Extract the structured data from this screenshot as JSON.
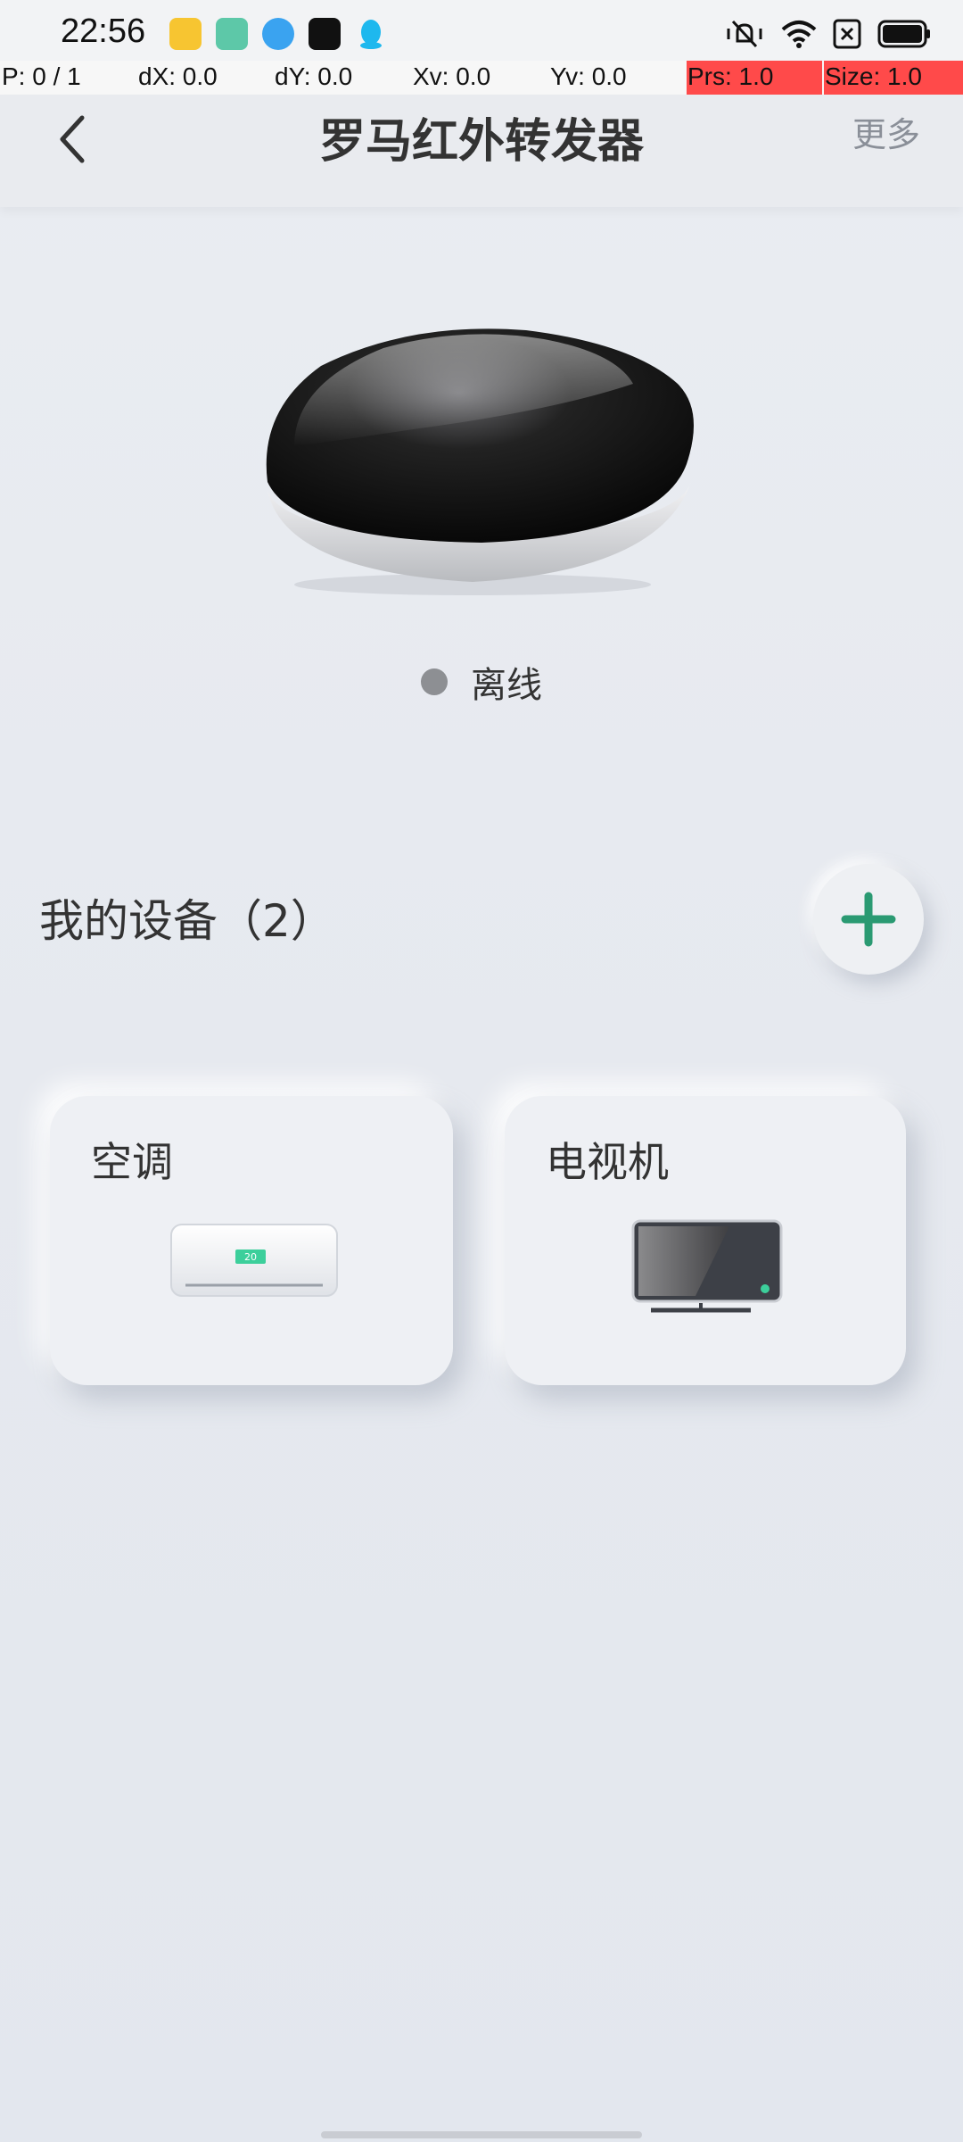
{
  "status_bar": {
    "time": "22:56"
  },
  "debug_bar": {
    "pointer": "P: 0 / 1",
    "dx": "dX: 0.0",
    "dy": "dY: 0.0",
    "xv": "Xv: 0.0",
    "yv": "Yv: 0.0",
    "prs": "Prs: 1.0",
    "size": "Size: 1.0"
  },
  "header": {
    "title": "罗马红外转发器",
    "more_label": "更多"
  },
  "device": {
    "status_text": "离线",
    "status_color": "#8d8f93"
  },
  "my_devices": {
    "title": "我的设备（2）",
    "cards": [
      {
        "label": "空调",
        "icon": "air-conditioner-icon",
        "display": "20"
      },
      {
        "label": "电视机",
        "icon": "television-icon"
      }
    ]
  },
  "colors": {
    "accent": "#2a9a72",
    "ac_display": "#3ccf9b",
    "debug_highlight": "#ff4a4a"
  }
}
